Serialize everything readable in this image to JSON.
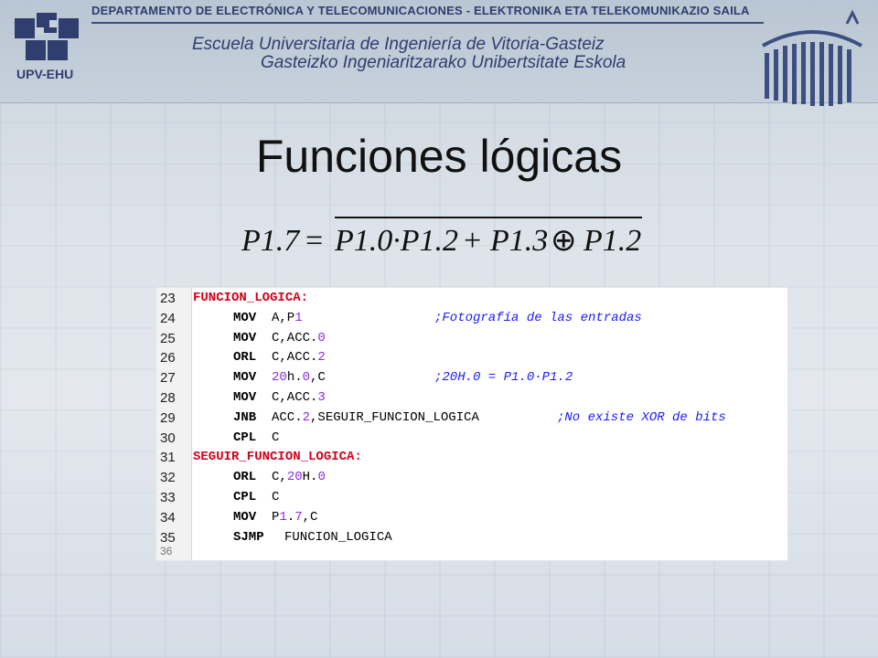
{
  "header": {
    "department": "DEPARTAMENTO DE ELECTRÓNICA Y TELECOMUNICACIONES - ELEKTRONIKA ETA TELEKOMUNIKAZIO SAILA",
    "school_line1": "Escuela Universitaria de Ingeniería de Vitoria-Gasteiz",
    "school_line2": "Gasteizko Ingeniaritzarako Unibertsitate Eskola",
    "logo_text": "UPV-EHU"
  },
  "slide": {
    "title": "Funciones lógicas",
    "formula": {
      "lhs": "P1.7",
      "equals": "=",
      "term1": "P1.0·P1.2",
      "plus": "+",
      "term2a": "P1.3",
      "xor": "⊕",
      "term2b": "P1.2"
    }
  },
  "code": {
    "lines": [
      {
        "n": "23",
        "label": "FUNCION_LOGICA:",
        "mn": "",
        "ops": "",
        "cmt": ""
      },
      {
        "n": "24",
        "label": "",
        "mn": "MOV",
        "ops": "A,P1",
        "cmt": ";Fotografía de las entradas"
      },
      {
        "n": "25",
        "label": "",
        "mn": "MOV",
        "ops": "C,ACC.0",
        "cmt": ""
      },
      {
        "n": "26",
        "label": "",
        "mn": "ORL",
        "ops": "C,ACC.2",
        "cmt": ""
      },
      {
        "n": "27",
        "label": "",
        "mn": "MOV",
        "ops": "20h.0,C",
        "cmt": ";20H.0 = P1.0·P1.2"
      },
      {
        "n": "28",
        "label": "",
        "mn": "MOV",
        "ops": "C,ACC.3",
        "cmt": ""
      },
      {
        "n": "29",
        "label": "",
        "mn": "JNB",
        "ops": "ACC.2,SEGUIR_FUNCION_LOGICA",
        "cmt": ";No existe XOR de bits"
      },
      {
        "n": "30",
        "label": "",
        "mn": "CPL",
        "ops": "C",
        "cmt": ""
      },
      {
        "n": "31",
        "label": "SEGUIR_FUNCION_LOGICA:",
        "mn": "",
        "ops": "",
        "cmt": ""
      },
      {
        "n": "32",
        "label": "",
        "mn": "ORL",
        "ops": "C,20H.0",
        "cmt": ""
      },
      {
        "n": "33",
        "label": "",
        "mn": "CPL",
        "ops": "C",
        "cmt": ""
      },
      {
        "n": "34",
        "label": "",
        "mn": "MOV",
        "ops": "P1.7,C",
        "cmt": ""
      },
      {
        "n": "35",
        "label": "",
        "mn": "SJMP",
        "ops": "FUNCION_LOGICA",
        "cmt": ""
      },
      {
        "n": "36",
        "label": "",
        "mn": "",
        "ops": "",
        "cmt": ""
      }
    ]
  },
  "colors": {
    "label": "#d2001a",
    "comment": "#1a1aff",
    "number": "#8a2be2",
    "header_text": "#2f3e6e"
  }
}
